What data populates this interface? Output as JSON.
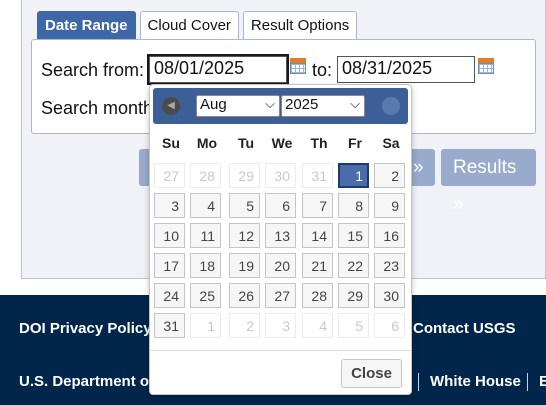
{
  "tabs": [
    {
      "label": "Date Range"
    },
    {
      "label": "Cloud Cover"
    },
    {
      "label": "Result Options"
    }
  ],
  "form": {
    "search_from_label": "Search from:",
    "start_date": "08/01/2025",
    "to_label": "to:",
    "end_date": "08/31/2025",
    "search_months_label": "Search month"
  },
  "buttons": {
    "prev_partial": "»",
    "results": "Results »"
  },
  "datepicker": {
    "prev_icon": "◀",
    "next_icon": "▶",
    "month": "Aug",
    "year": "2025",
    "chevron": "⌵",
    "weekdays": [
      "Su",
      "Mo",
      "Tu",
      "We",
      "Th",
      "Fr",
      "Sa"
    ],
    "days": [
      "27",
      "28",
      "29",
      "30",
      "31",
      "1",
      "2",
      "3",
      "4",
      "5",
      "6",
      "7",
      "8",
      "9",
      "10",
      "11",
      "12",
      "13",
      "14",
      "15",
      "16",
      "17",
      "18",
      "19",
      "20",
      "21",
      "22",
      "23",
      "24",
      "25",
      "26",
      "27",
      "28",
      "29",
      "30",
      "31",
      "1",
      "2",
      "3",
      "4",
      "5",
      "6"
    ],
    "other_month_indices": [
      0,
      1,
      2,
      3,
      4,
      36,
      37,
      38,
      39,
      40,
      41
    ],
    "selected_index": 5,
    "close_label": "Close"
  },
  "footer": {
    "doi_privacy": "DOI Privacy Policy",
    "contact": "Contact USGS",
    "us_dept": "U.S. Department of",
    "white_house": "White House",
    "trailing": "E"
  }
}
